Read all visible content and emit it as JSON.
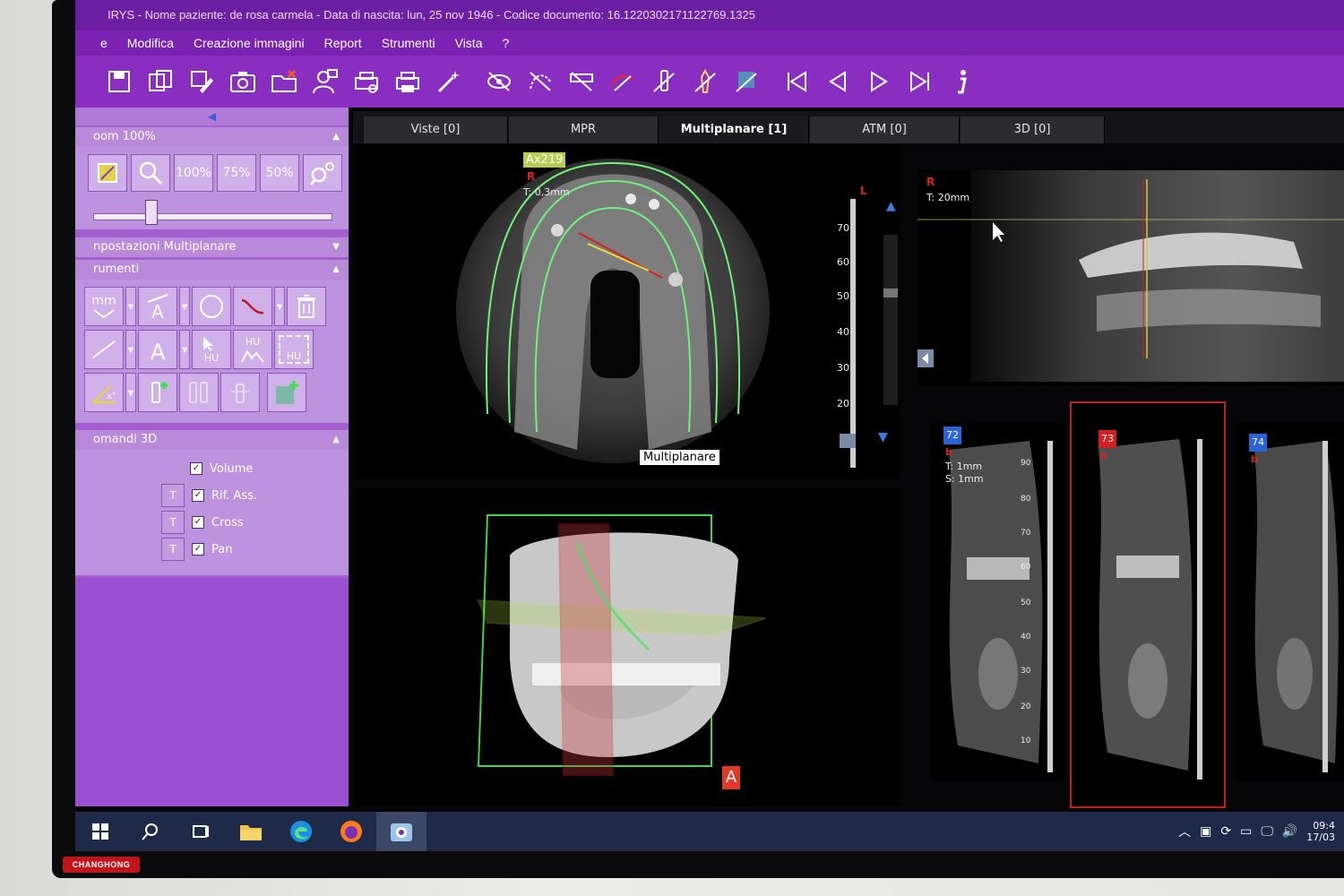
{
  "window": {
    "title": "IRYS - Nome paziente: de rosa carmela - Data di nascita: lun, 25 nov 1946 - Codice documento: 16.1220302171122769.1325"
  },
  "menu": [
    "e",
    "Modifica",
    "Creazione immagini",
    "Report",
    "Strumenti",
    "Vista",
    "?"
  ],
  "left_panel": {
    "zoom_title": "oom 100%",
    "zoom_buttons": [
      "100%",
      "75%",
      "50%"
    ],
    "section_multiplanar": "npostazioni Multiplanare",
    "section_tools": "rumenti",
    "tool_unit": "mm",
    "hu_label": "HU",
    "section_3d": "omandi 3D",
    "options_3d": [
      {
        "label": "Volume",
        "checked": true,
        "t_button": false
      },
      {
        "label": "Rif. Ass.",
        "checked": true,
        "t_button": true
      },
      {
        "label": "Cross",
        "checked": true,
        "t_button": true
      },
      {
        "label": "Pan",
        "checked": true,
        "t_button": true
      }
    ],
    "t_label": "T"
  },
  "tabs": [
    {
      "label": "Viste [0]",
      "active": false
    },
    {
      "label": "MPR",
      "active": false
    },
    {
      "label": "Multiplanare [1]",
      "active": true
    },
    {
      "label": "ATM [0]",
      "active": false
    },
    {
      "label": "3D [0]",
      "active": false
    }
  ],
  "axial_view": {
    "slice_label": "Ax219",
    "orientation": "R",
    "thickness": "T: 0,3mm",
    "overlay_label": "Multiplanare",
    "ruler_ticks": [
      "70",
      "60",
      "50",
      "40",
      "30",
      "20"
    ],
    "corner_mark": "L"
  },
  "panoramic_view": {
    "orientation": "R",
    "thickness": "T: 20mm"
  },
  "cross_sections": [
    {
      "number": "72",
      "sub": "b",
      "thickness": "T: 1mm",
      "step": "S: 1mm",
      "color": "#2a64d6"
    },
    {
      "number": "73",
      "sub": "b",
      "color": "#d21f1f"
    },
    {
      "number": "74",
      "sub": "b",
      "color": "#2a64d6"
    }
  ],
  "cross_ruler_ticks": [
    "90",
    "80",
    "70",
    "60",
    "50",
    "40",
    "30",
    "20",
    "10"
  ],
  "view3d": {
    "orientation_marker": "A"
  },
  "taskbar": {
    "clock_time": "09:4",
    "clock_date": "17/03"
  },
  "brand": "CHANGHONG",
  "colors": {
    "accent_purple": "#8a2ec2",
    "panel_purple": "#a35fd0",
    "cross_section_selected": "#c0201f",
    "guide_green": "#6df27a"
  }
}
